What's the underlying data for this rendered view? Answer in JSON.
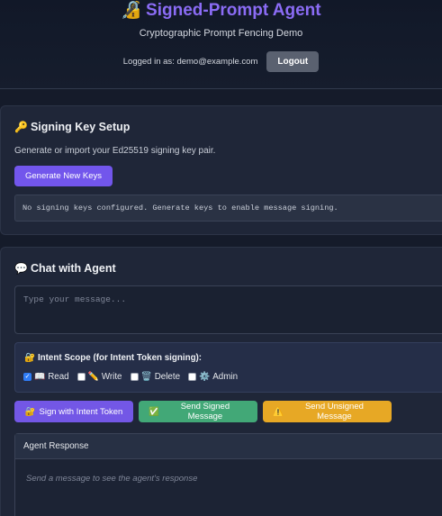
{
  "header": {
    "title": "Signed-Prompt Agent",
    "title_icon": "🔏",
    "subtitle": "Cryptographic Prompt Fencing Demo",
    "login_text": "Logged in as: demo@example.com",
    "logout_label": "Logout"
  },
  "keys": {
    "icon": "🔑",
    "title": "Signing Key Setup",
    "description": "Generate or import your Ed25519 signing key pair.",
    "generate_label": "Generate New Keys",
    "status": "No signing keys configured. Generate keys to enable message signing."
  },
  "chat": {
    "icon": "💬",
    "title": "Chat with Agent",
    "input_value": "",
    "input_placeholder": "Type your message...",
    "scope": {
      "icon": "🔐",
      "title": "Intent Scope (for Intent Token signing):",
      "options": [
        {
          "icon": "📖",
          "label": "Read",
          "checked": true
        },
        {
          "icon": "✏️",
          "label": "Write",
          "checked": false
        },
        {
          "icon": "🗑️",
          "label": "Delete",
          "checked": false
        },
        {
          "icon": "⚙️",
          "label": "Admin",
          "checked": false
        }
      ]
    },
    "buttons": {
      "intent_icon": "🔐",
      "intent_label": "Sign with Intent Token",
      "signed_icon": "✅",
      "signed_label": "Send Signed Message",
      "unsigned_icon": "⚠️",
      "unsigned_label": "Send Unsigned Message"
    },
    "response": {
      "header": "Agent Response",
      "placeholder": "Send a message to see the agent's response"
    }
  },
  "colors": {
    "accent": "#7256ec",
    "success": "#42a877",
    "warning": "#e7a825",
    "background": "#151b2a"
  }
}
